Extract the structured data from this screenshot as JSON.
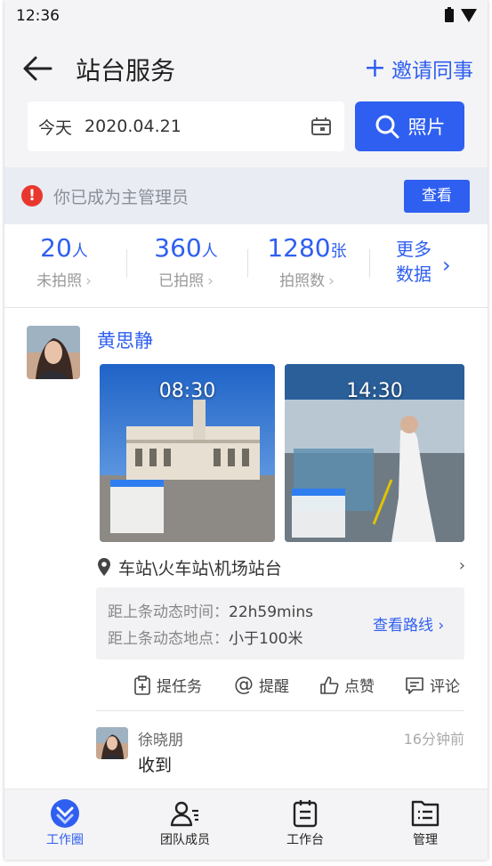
{
  "status_bar": {
    "time": "12:36"
  },
  "header": {
    "title": "站台服务",
    "invite_label": "邀请同事",
    "date_label": "今天",
    "date_value": "2020.04.21",
    "photo_button_label": "照片"
  },
  "notice": {
    "text": "你已成为主管理员",
    "view_label": "查看"
  },
  "stats": {
    "items": [
      {
        "value": "20",
        "unit": "人",
        "label": "未拍照"
      },
      {
        "value": "360",
        "unit": "人",
        "label": "已拍照"
      },
      {
        "value": "1280",
        "unit": "张",
        "label": "拍照数"
      }
    ],
    "more_line1": "更多",
    "more_line2": "数据"
  },
  "post": {
    "author": "黄思静",
    "photos": [
      {
        "time": "08:30"
      },
      {
        "time": "14:30"
      }
    ],
    "location": "车站\\火车站\\机场站台",
    "last_time_label": "距上条动态时间：",
    "last_time_value": "22h59mins",
    "last_place_label": "距上条动态地点：",
    "last_place_value": "小于100米",
    "route_label": "查看路线",
    "actions": {
      "task": "提任务",
      "remind": "提醒",
      "like": "点赞",
      "comment": "评论"
    },
    "comment": {
      "author": "徐晓朋",
      "time": "16分钟前",
      "text": "收到"
    }
  },
  "tabbar": {
    "items": [
      {
        "label": "工作圈",
        "icon": "work-circle-icon",
        "active": true
      },
      {
        "label": "团队成员",
        "icon": "team-icon",
        "active": false
      },
      {
        "label": "工作台",
        "icon": "clipboard-icon",
        "active": false
      },
      {
        "label": "管理",
        "icon": "manage-list-icon",
        "active": false
      }
    ]
  },
  "colors": {
    "accent": "#2f5ff0",
    "warning": "#e8382e",
    "background": "#f4f4f6"
  }
}
